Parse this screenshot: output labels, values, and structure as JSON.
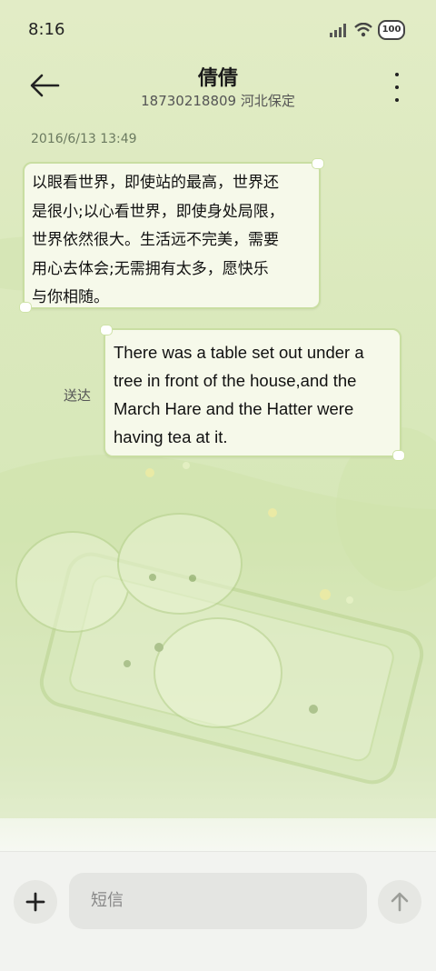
{
  "status_bar": {
    "time": "8:16",
    "battery": "100",
    "icons": [
      "signal-icon",
      "wifi-icon",
      "battery-icon"
    ]
  },
  "header": {
    "contact_name": "倩倩",
    "contact_subtitle": "18730218809 河北保定",
    "icons": [
      "back-arrow-icon",
      "more-vertical-icon"
    ]
  },
  "conversation": {
    "timestamp": "2016/6/13 13:49",
    "messages": [
      {
        "direction": "incoming",
        "lines": [
          "以眼看世界，即使站的最高，世界还",
          "是很小;以心看世界，即使身处局限，",
          "世界依然很大。生活远不完美，需要",
          "用心去体会;无需拥有太多，愿快乐",
          "与你相随。"
        ]
      },
      {
        "direction": "outgoing",
        "lines": [
          "There was a table set out under a",
          "tree in front of the house,and the",
          "March Hare and the Hatter were",
          "having tea at it."
        ],
        "status": "送达"
      }
    ]
  },
  "composer": {
    "placeholder": "短信",
    "icons": [
      "plus-icon",
      "send-arrow-icon"
    ]
  },
  "colors": {
    "background": "#dbe9bd",
    "bubble_fill": "#f6f9ea",
    "bubble_border": "#c9dea2"
  }
}
